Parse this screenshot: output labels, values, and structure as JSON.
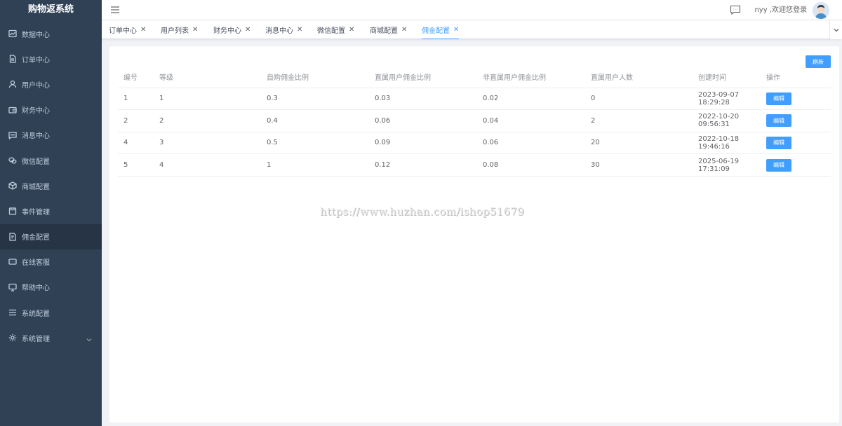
{
  "app": {
    "title": "购物返系统"
  },
  "sidebar": {
    "items": [
      {
        "label": "数据中心",
        "icon": "chart-icon"
      },
      {
        "label": "订单中心",
        "icon": "document-icon"
      },
      {
        "label": "用户中心",
        "icon": "user-icon"
      },
      {
        "label": "财务中心",
        "icon": "wallet-icon"
      },
      {
        "label": "消息中心",
        "icon": "message-icon"
      },
      {
        "label": "微信配置",
        "icon": "wechat-icon"
      },
      {
        "label": "商城配置",
        "icon": "box-icon"
      },
      {
        "label": "事件管理",
        "icon": "calendar-icon"
      },
      {
        "label": "佣金配置",
        "icon": "commission-icon",
        "active": true
      },
      {
        "label": "在线客服",
        "icon": "chat-icon"
      },
      {
        "label": "帮助中心",
        "icon": "monitor-icon"
      },
      {
        "label": "系统配置",
        "icon": "list-icon"
      },
      {
        "label": "系统管理",
        "icon": "gear-icon",
        "has_submenu": true
      }
    ]
  },
  "header": {
    "greeting": "nyy ,欢迎您登录"
  },
  "tabs": [
    {
      "label": "订单中心"
    },
    {
      "label": "用户列表"
    },
    {
      "label": "财务中心"
    },
    {
      "label": "消息中心"
    },
    {
      "label": "微信配置"
    },
    {
      "label": "商城配置"
    },
    {
      "label": "佣金配置",
      "active": true
    }
  ],
  "toolbar": {
    "refresh_label": "刷新"
  },
  "table": {
    "columns": [
      "编号",
      "等级",
      "自购佣金比例",
      "直属用户佣金比例",
      "非直属用户佣金比例",
      "直属用户人数",
      "创建时间",
      "操作"
    ],
    "rows": [
      [
        "1",
        "1",
        "0.3",
        "0.03",
        "0.02",
        "0",
        "2023-09-07 18:29:28"
      ],
      [
        "2",
        "2",
        "0.4",
        "0.06",
        "0.04",
        "2",
        "2022-10-20 09:56:31"
      ],
      [
        "4",
        "3",
        "0.5",
        "0.09",
        "0.06",
        "20",
        "2022-10-18 19:46:16"
      ],
      [
        "5",
        "4",
        "1",
        "0.12",
        "0.08",
        "30",
        "2025-06-19 17:31:09"
      ]
    ],
    "edit_label": "编辑"
  },
  "watermark": "https://www.huzhan.com/ishop51679",
  "colors": {
    "sidebar_bg": "#304156",
    "primary": "#409eff"
  }
}
